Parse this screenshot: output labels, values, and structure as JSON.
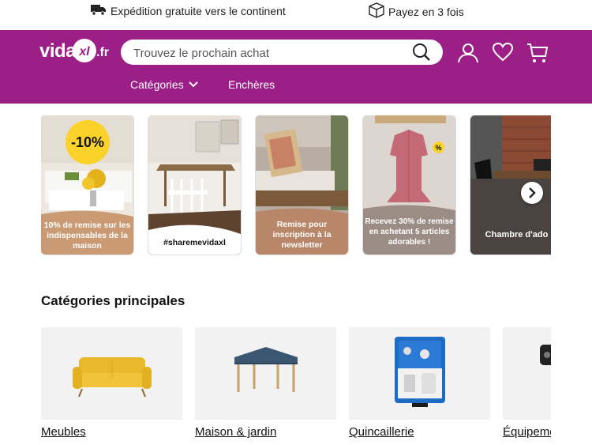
{
  "topbar": {
    "shipping": {
      "icon": "truck-icon",
      "text": "Expédition gratuite vers le continent"
    },
    "payment": {
      "icon": "box-icon",
      "text": "Payez en 3 fois"
    }
  },
  "header": {
    "logo": {
      "text": "vida",
      "mark": "xl",
      "suffix": ".fr"
    },
    "search": {
      "placeholder": "Trouvez le prochain achat",
      "value": ""
    },
    "icons": [
      "user-icon",
      "heart-icon",
      "cart-icon"
    ],
    "nav": {
      "categories_label": "Catégories",
      "auctions_label": "Enchères"
    },
    "brand_color": "#9b1f87"
  },
  "promos": [
    {
      "label": "10% de remise sur les indispensables de la maison",
      "badge": "-10%"
    },
    {
      "label": "#sharemevidaxl"
    },
    {
      "label": "Remise pour inscription à la newsletter"
    },
    {
      "label": "Recevez 30% de remise en achetant 5 articles adorables !",
      "badge": "%"
    },
    {
      "label": "Chambre d'ado"
    }
  ],
  "main": {
    "section_title": "Catégories principales",
    "categories": [
      {
        "name": "Meubles"
      },
      {
        "name": "Maison & jardin"
      },
      {
        "name": "Quincaillerie"
      },
      {
        "name": "Équipement"
      }
    ]
  }
}
